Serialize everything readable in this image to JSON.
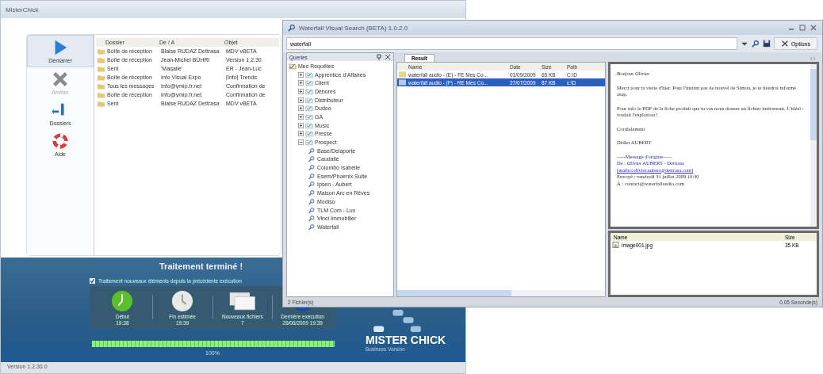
{
  "back_window": {
    "title": "MisterChick",
    "toolbar": [
      {
        "label": "Démarrer",
        "kind": "play",
        "selected": true,
        "disabled": false
      },
      {
        "label": "Arrêter",
        "kind": "stop",
        "selected": false,
        "disabled": true
      },
      {
        "label": "Dossiers",
        "kind": "folders",
        "selected": false,
        "disabled": false
      },
      {
        "label": "Aide",
        "kind": "help",
        "selected": false,
        "disabled": false
      }
    ],
    "columns": [
      "Dossier",
      "De / A",
      "Objet"
    ],
    "rows": [
      [
        "Boîte de réception",
        "Blaise RUDAZ Dettrasa",
        "MDV vBETA"
      ],
      [
        "Boîte de réception",
        "Jean-Michel BÜHRI",
        "Version 1.2.30"
      ],
      [
        "Sent",
        "'Magalie'",
        "ER - Jean-Luc"
      ],
      [
        "Boîte de réception",
        "Info Visual Expo",
        "[Info] Trends"
      ],
      [
        "Tous les messages",
        "Info@ymip.fr.net",
        "Confirmation de"
      ],
      [
        "Boîte de réception",
        "Info@ymip.fr.net",
        "Confirmation de"
      ],
      [
        "Sent",
        "Blaise RUDAZ Dettrasa",
        "MDV vBETA"
      ]
    ],
    "status_panel": {
      "heading": "Traitement terminé !",
      "option": {
        "label": "Traitement nouveaux éléments depuis la précédente exécution",
        "checked": true
      },
      "stats": [
        {
          "kind": "start",
          "label": "Début",
          "value": "19:38"
        },
        {
          "kind": "end",
          "label": "Fin estimée",
          "value": "19:39"
        },
        {
          "kind": "files",
          "label": "Nouveaux fichiers",
          "value": "7"
        },
        {
          "kind": "last",
          "label": "Dernière exécution",
          "value": "26/06/2009 19:39"
        }
      ],
      "progress": {
        "level": 1,
        "reading": "100%"
      },
      "logo": {
        "name": "MISTER CHICK",
        "edition": "Business Version"
      }
    },
    "status_bar": "Version 1.2.30.0"
  },
  "front_window": {
    "title": "Waterfall Visual Search (BETA) 1.0.2.0",
    "search": {
      "value": "waterfall"
    },
    "options_button": "Options",
    "queries_title": "Queries",
    "tree": [
      {
        "label": "Mes Requêtes",
        "kind": "root",
        "expanded": true,
        "children": [
          {
            "label": "Apprentice d'Affaires",
            "kind": "folder",
            "expanded": false
          },
          {
            "label": "Client",
            "kind": "folder",
            "expanded": false
          },
          {
            "label": "Debores",
            "kind": "folder",
            "expanded": false
          },
          {
            "label": "Distributeur",
            "kind": "folder",
            "expanded": false
          },
          {
            "label": "Dudoo",
            "kind": "folder",
            "expanded": false
          },
          {
            "label": "GA",
            "kind": "folder",
            "expanded": false
          },
          {
            "label": "Music",
            "kind": "folder",
            "expanded": false
          },
          {
            "label": "Presse",
            "kind": "folder",
            "expanded": false
          },
          {
            "label": "Prospect",
            "kind": "folder",
            "expanded": true,
            "children": [
              {
                "label": "Base/Delaporte",
                "kind": "query"
              },
              {
                "label": "Caudalie",
                "kind": "query"
              },
              {
                "label": "Colombo Isabelle",
                "kind": "query"
              },
              {
                "label": "Esem/Phoenix Suite",
                "kind": "query"
              },
              {
                "label": "Ipsen - Aubert",
                "kind": "query"
              },
              {
                "label": "Maison Arc en Rêves",
                "kind": "query"
              },
              {
                "label": "Modiso",
                "kind": "query"
              },
              {
                "label": "TLM Com - Lux",
                "kind": "query"
              },
              {
                "label": "Vinci Immobilier",
                "kind": "query"
              },
              {
                "label": "Waterfall",
                "kind": "query"
              }
            ]
          }
        ]
      }
    ],
    "tab": "Result",
    "result_columns": [
      "Name",
      "Date",
      "Size",
      "Path"
    ],
    "results": [
      {
        "name": "waterfall audio - (E) - FE Mes Co...",
        "date": "01/09/2009",
        "size": "65 KB",
        "path": "C:\\D",
        "selected": false
      },
      {
        "name": "waterfall audio - (F) - RE Mes Co...",
        "date": "27/07/2009",
        "size": "87 KB",
        "path": "c:\\D",
        "selected": true
      }
    ],
    "preview": [
      {
        "kind": "text",
        "text": "Bonjour Olivier"
      },
      {
        "kind": "text",
        "text": "Merci pour ta visite d'hier. Pour l'instant pas de nouvel de Simon, je te tiendrai informé asap."
      },
      {
        "kind": "text",
        "text": "Pour info le PDF de la fiche produit que tu vas nous donner un fichier intéressant. L'idéal : voulait l'explosion !"
      },
      {
        "kind": "text",
        "text": "Cordialement"
      },
      {
        "kind": "text",
        "text": "Didier AUBERT"
      },
      {
        "kind": "header",
        "text": "-----Message d'origine-----"
      },
      {
        "kind": "header",
        "text": "De : Olivier AUBERT - Dettrasa"
      },
      {
        "kind": "link",
        "text": "[mailto:olivier.aubert@dettrasa.com]"
      },
      {
        "kind": "plain",
        "text": "Envoyé : vendredi 31 juillet 2009 10:30"
      },
      {
        "kind": "plain",
        "text": "À : contact@waterfallaudio.com"
      }
    ],
    "attachment_columns": [
      "Name",
      "Size"
    ],
    "attachments": [
      {
        "name": "image001.jpg",
        "size": "35 KB"
      }
    ],
    "status_left": "2 Fichier(s)",
    "status_right": "0.05 Seconde(s)"
  }
}
